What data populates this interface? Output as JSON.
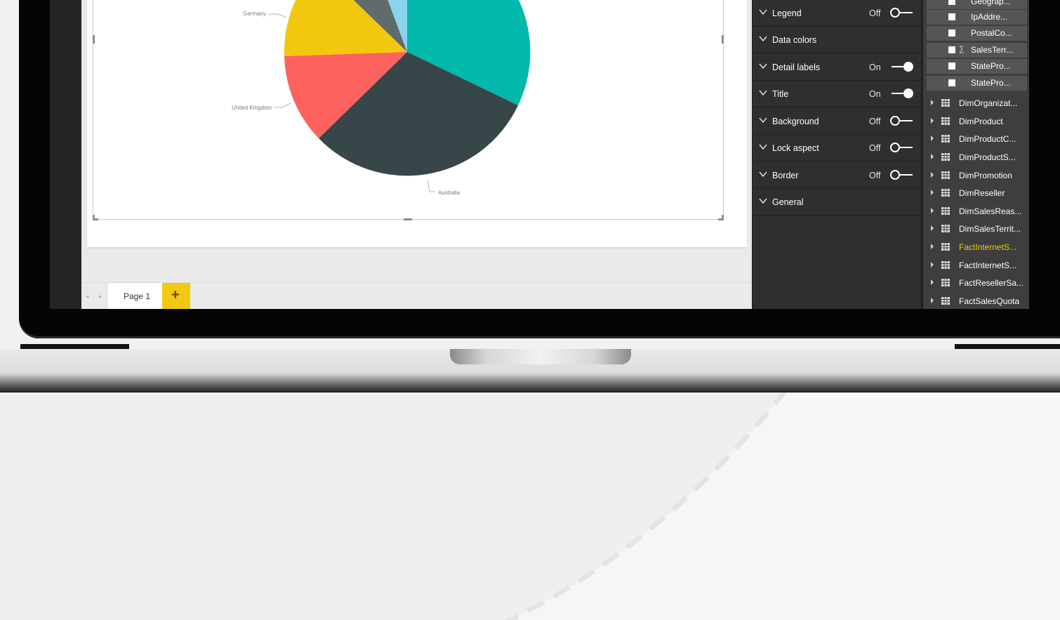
{
  "pie_chart": {
    "labels": [
      "Germany",
      "United Kingdom",
      "Australia"
    ],
    "colors": {
      "teal": "#01b8aa",
      "dark_slate": "#374649",
      "red": "#fd625e",
      "yellow": "#f2c80f",
      "gray": "#5f6b6d",
      "light_blue": "#8ad4eb"
    }
  },
  "page_tabs": {
    "nav_arrows": "◂ ▸",
    "tabs": [
      {
        "label": "Page 1"
      }
    ],
    "add_label": "+"
  },
  "format_pane": {
    "items": [
      {
        "label": "Legend",
        "state": "Off",
        "on": false
      },
      {
        "label": "Data colors"
      },
      {
        "label": "Detail labels",
        "state": "On",
        "on": true
      },
      {
        "label": "Title",
        "state": "On",
        "on": true
      },
      {
        "label": "Background",
        "state": "Off",
        "on": false
      },
      {
        "label": "Lock aspect",
        "state": "Off",
        "on": false
      },
      {
        "label": "Border",
        "state": "Off",
        "on": false
      },
      {
        "label": "General"
      }
    ]
  },
  "fields_pane": {
    "subfields": [
      {
        "label": "Geograp...",
        "sigma": false
      },
      {
        "label": "IpAddre...",
        "sigma": false
      },
      {
        "label": "PostalCo...",
        "sigma": false
      },
      {
        "label": "SalesTerr...",
        "sigma": true,
        "sigma_glyph": "∑"
      },
      {
        "label": "StatePro...",
        "sigma": false
      },
      {
        "label": "StatePro...",
        "sigma": false
      }
    ],
    "tables": [
      {
        "label": "DimOrganizat...",
        "active": false
      },
      {
        "label": "DimProduct",
        "active": false
      },
      {
        "label": "DimProductC...",
        "active": false
      },
      {
        "label": "DimProductS...",
        "active": false
      },
      {
        "label": "DimPromotion",
        "active": false
      },
      {
        "label": "DimReseller",
        "active": false
      },
      {
        "label": "DimSalesReas...",
        "active": false
      },
      {
        "label": "DimSalesTerrit...",
        "active": false
      },
      {
        "label": "FactInternetS...",
        "active": true
      },
      {
        "label": "FactInternetS...",
        "active": false
      },
      {
        "label": "FactResellerSa...",
        "active": false
      },
      {
        "label": "FactSalesQuota",
        "active": false
      }
    ]
  }
}
